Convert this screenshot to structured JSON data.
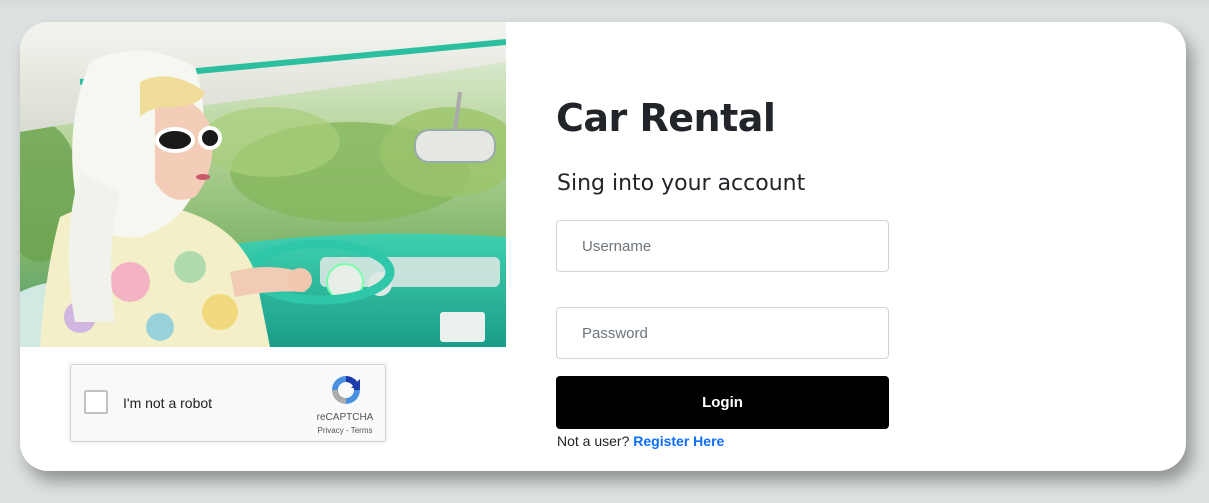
{
  "brand": {
    "title": "Car Rental",
    "subtitle": "Sing into your account"
  },
  "photo": {
    "icon": "woman-driving-vintage-car-photo"
  },
  "recaptcha": {
    "checkbox_label": "I'm not a robot",
    "brand": "reCAPTCHA",
    "privacy": "Privacy",
    "separator": " - ",
    "terms": "Terms",
    "icon": "recaptcha-logo-icon"
  },
  "form": {
    "username_placeholder": "Username",
    "password_placeholder": "Password",
    "login_label": "Login",
    "register_prompt": "Not a user? ",
    "register_link": "Register Here"
  },
  "colors": {
    "background": "#dde1e1",
    "card": "#ffffff",
    "button": "#000000",
    "link": "#0d6efd"
  }
}
